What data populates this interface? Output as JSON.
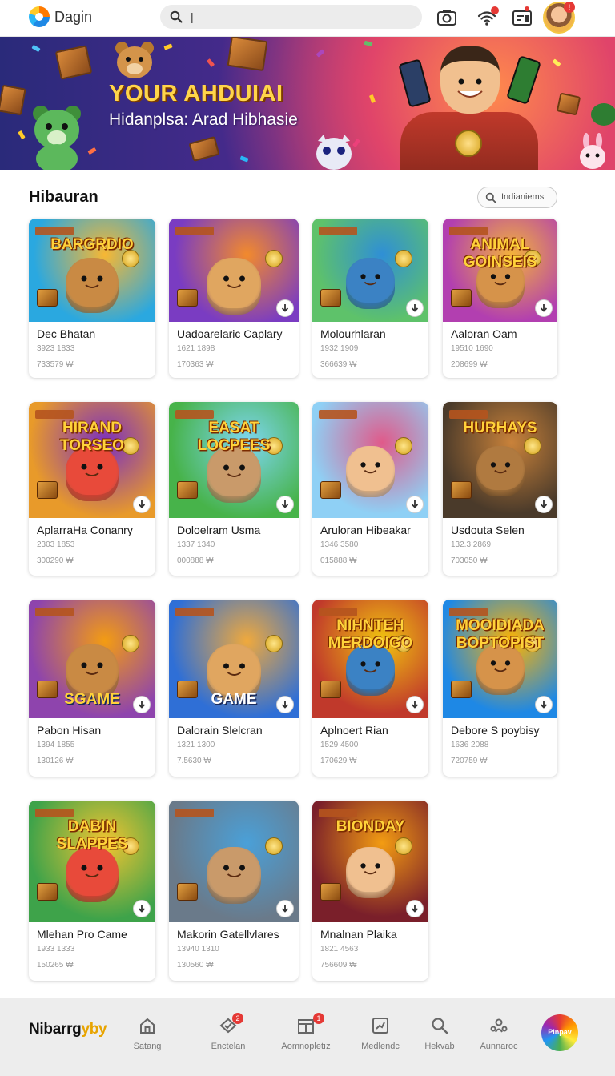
{
  "header": {
    "app_name": "Dagin",
    "search_value": "|",
    "icons": [
      "logo-icon",
      "search-icon",
      "camera-icon",
      "wifi-icon",
      "inbox-icon",
      "avatar"
    ]
  },
  "banner": {
    "title": "YOUR AHDUIAI",
    "subtitle": "Hidanplsa: Arad Hibhasie"
  },
  "section": {
    "title": "Hibauran",
    "filter_label": "Indianiems"
  },
  "cards": [
    {
      "title": "Dec Bhatan",
      "meta1": "3923 1833",
      "meta2": "733579 ₩",
      "art": "BARGRDIO"
    },
    {
      "title": "Uadoarelaric Caplary",
      "meta1": "1621 1898",
      "meta2": "170363 ₩",
      "art": ""
    },
    {
      "title": "Molourhlaran",
      "meta1": "1932 1909",
      "meta2": "366639 ₩",
      "art": ""
    },
    {
      "title": "Aaloran Oam",
      "meta1": "19510 1690",
      "meta2": "208699 ₩",
      "art": "ANIMAL GOINSEIS"
    },
    {
      "title": "AplarraHa Conanry",
      "meta1": "2303 1853",
      "meta2": "300290 ₩",
      "art": "HIRAND TORSEO"
    },
    {
      "title": "Doloelram Usma",
      "meta1": "1337 1340",
      "meta2": "000888 ₩",
      "art": "EASAT LOCPEES"
    },
    {
      "title": "Aruloran Hibeakar",
      "meta1": "1346 3580",
      "meta2": "015888 ₩",
      "art": ""
    },
    {
      "title": "Usdouta Selen",
      "meta1": "132.3 2869",
      "meta2": "703050 ₩",
      "art": "HURHAYS"
    },
    {
      "title": "Pabon Hisan",
      "meta1": "1394 1855",
      "meta2": "130126 ₩",
      "art": "SGAME"
    },
    {
      "title": "Dalorain Slelcran",
      "meta1": "1321 1300",
      "meta2": "7.5630 ₩",
      "art": "GAME"
    },
    {
      "title": "Aplnoert Rian",
      "meta1": "1529 4500",
      "meta2": "170629 ₩",
      "art": "NIHNTEH MERDOIGO"
    },
    {
      "title": "Debore S poybisy",
      "meta1": "1636 2088",
      "meta2": "720759 ₩",
      "art": "MOOIDIADA BOPTOPIST"
    },
    {
      "title": "Mlehan Pro Came",
      "meta1": "1933 1333",
      "meta2": "150265 ₩",
      "art": "DABIN SLAPPES"
    },
    {
      "title": "Makorin Gatellvlares",
      "meta1": "13940 1310",
      "meta2": "130560 ₩",
      "art": ""
    },
    {
      "title": "Mnalnan Plaika",
      "meta1": "1821 4563",
      "meta2": "756609 ₩",
      "art": "BIONDAY"
    }
  ],
  "nav": {
    "brand_prefix": "Nibarrg",
    "brand_suffix": "yby",
    "items": [
      {
        "label": "Satang",
        "badge": ""
      },
      {
        "label": "Enctelan",
        "badge": "2"
      },
      {
        "label": "Aomnopletız",
        "badge": "1"
      },
      {
        "label": "Medlendc",
        "badge": ""
      },
      {
        "label": "Hekvab",
        "badge": ""
      },
      {
        "label": "Aunnaroc",
        "badge": ""
      }
    ],
    "avatar_label": "Pinpav"
  },
  "colors": {
    "accent": "#e53935",
    "banner_title": "#ffd54a",
    "brand_suffix": "#e8a400"
  }
}
